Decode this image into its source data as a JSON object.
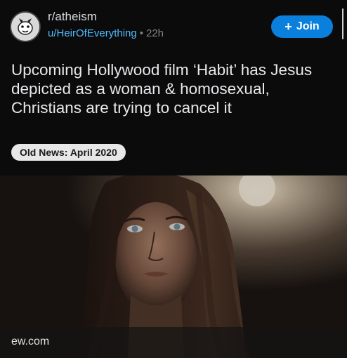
{
  "post": {
    "subreddit": "r/atheism",
    "author": "u/HeirOfEverything",
    "separator": "•",
    "age": "22h",
    "join_label": "Join",
    "title": "Upcoming Hollywood film ‘Habit’ has Jesus depicted as a woman & homosexual, Christians are trying to cancel it",
    "flair": "Old News: April 2020",
    "link_domain": "ew.com"
  },
  "icons": {
    "avatar": "subreddit-avatar",
    "plus": "plus-icon"
  },
  "colors": {
    "background": "#0b0b0c",
    "join_button": "#0b7fdc",
    "username": "#4fbcff",
    "flair_bg": "#e7e7e7"
  }
}
